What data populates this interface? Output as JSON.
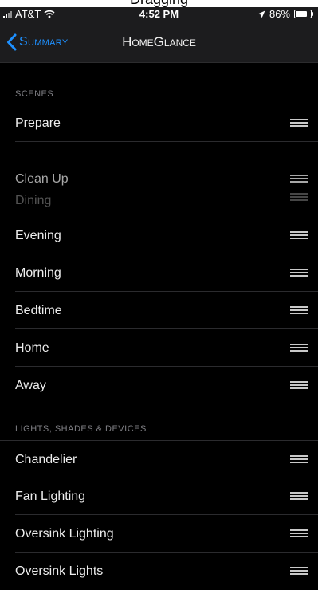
{
  "banner": {
    "text": "Dragging"
  },
  "status_bar": {
    "carrier": "AT&T",
    "time": "4:52 PM",
    "battery": "86%",
    "battery_level": 0.86
  },
  "nav": {
    "back_label": "Summary",
    "title": "HomeGlance"
  },
  "sections": {
    "scenes_header": "Scenes",
    "devices_header": "Lights, Shades & Devices"
  },
  "rows": {
    "prepare": "Prepare",
    "dragging": "Clean Up",
    "dining": "Dining",
    "evening": "Evening",
    "morning": "Morning",
    "bedtime": "Bedtime",
    "home": "Home",
    "away": "Away",
    "chandelier": "Chandelier",
    "fan_lighting": "Fan Lighting",
    "oversink_lighting": "Oversink Lighting",
    "oversink_lights": "Oversink Lights"
  },
  "colors": {
    "accent": "#1e90ff",
    "background": "#000000",
    "bar": "#1c1c1e"
  },
  "icons": {
    "back": "chevron-left-icon",
    "reorder": "reorder-handle-icon",
    "wifi": "wifi-icon",
    "location": "location-arrow-icon",
    "battery": "battery-icon",
    "signal": "signal-bars-icon"
  }
}
